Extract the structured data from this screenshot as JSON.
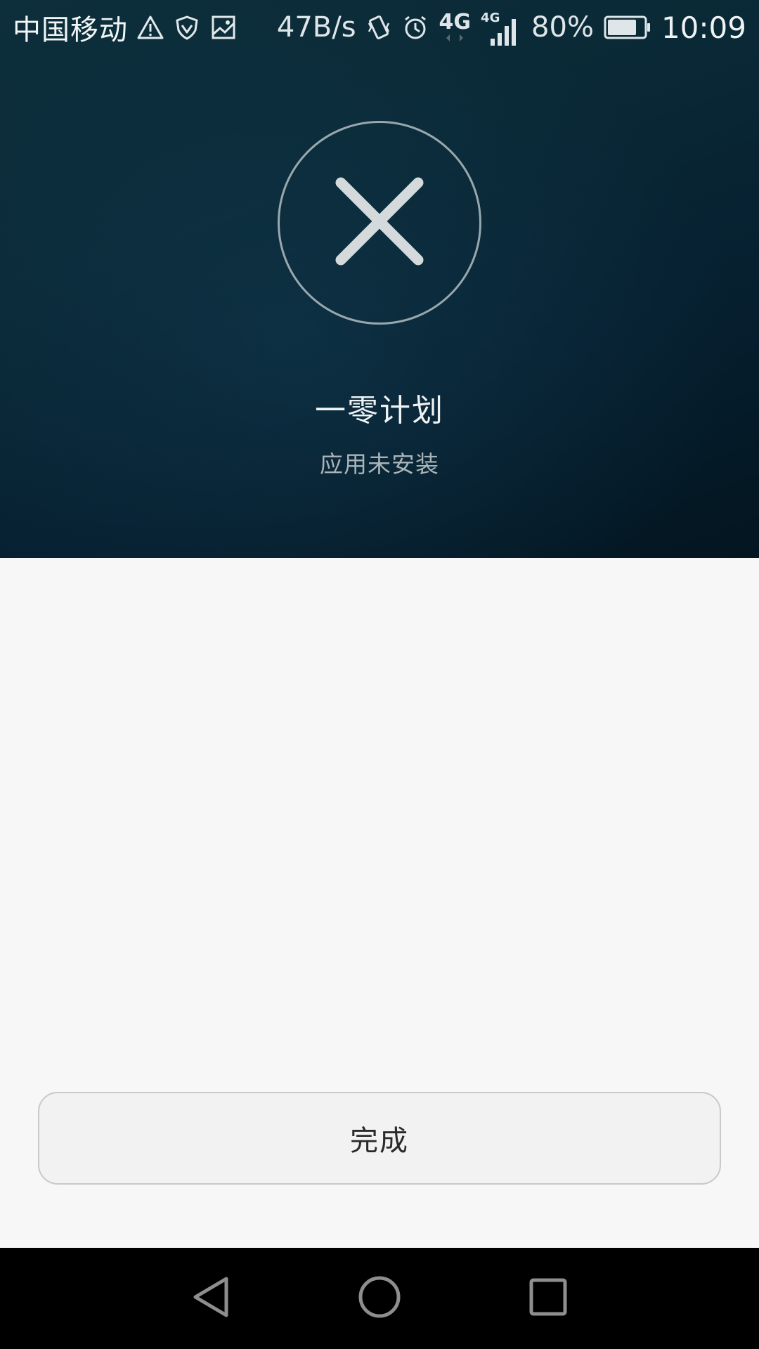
{
  "status_bar": {
    "carrier": "中国移动",
    "network_speed": "47B/s",
    "network_type_1": "4G",
    "network_type_2": "4G",
    "battery_percent": "80%",
    "battery_level": 0.8,
    "time": "10:09",
    "icons": [
      "warning-icon",
      "shield-icon",
      "image-icon",
      "vibrate-icon",
      "alarm-icon",
      "data-arrows-icon",
      "signal-icon",
      "battery-icon"
    ]
  },
  "result": {
    "icon": "close-icon",
    "app_name": "一零计划",
    "message": "应用未安装"
  },
  "actions": {
    "done_label": "完成"
  },
  "navigation": {
    "icons": [
      "back-icon",
      "home-icon",
      "recents-icon"
    ]
  },
  "colors": {
    "hero_dark": "#062030",
    "content_bg": "#f7f7f7",
    "button_bg": "#f2f2f2",
    "icon_stroke": "#d4d9db"
  }
}
